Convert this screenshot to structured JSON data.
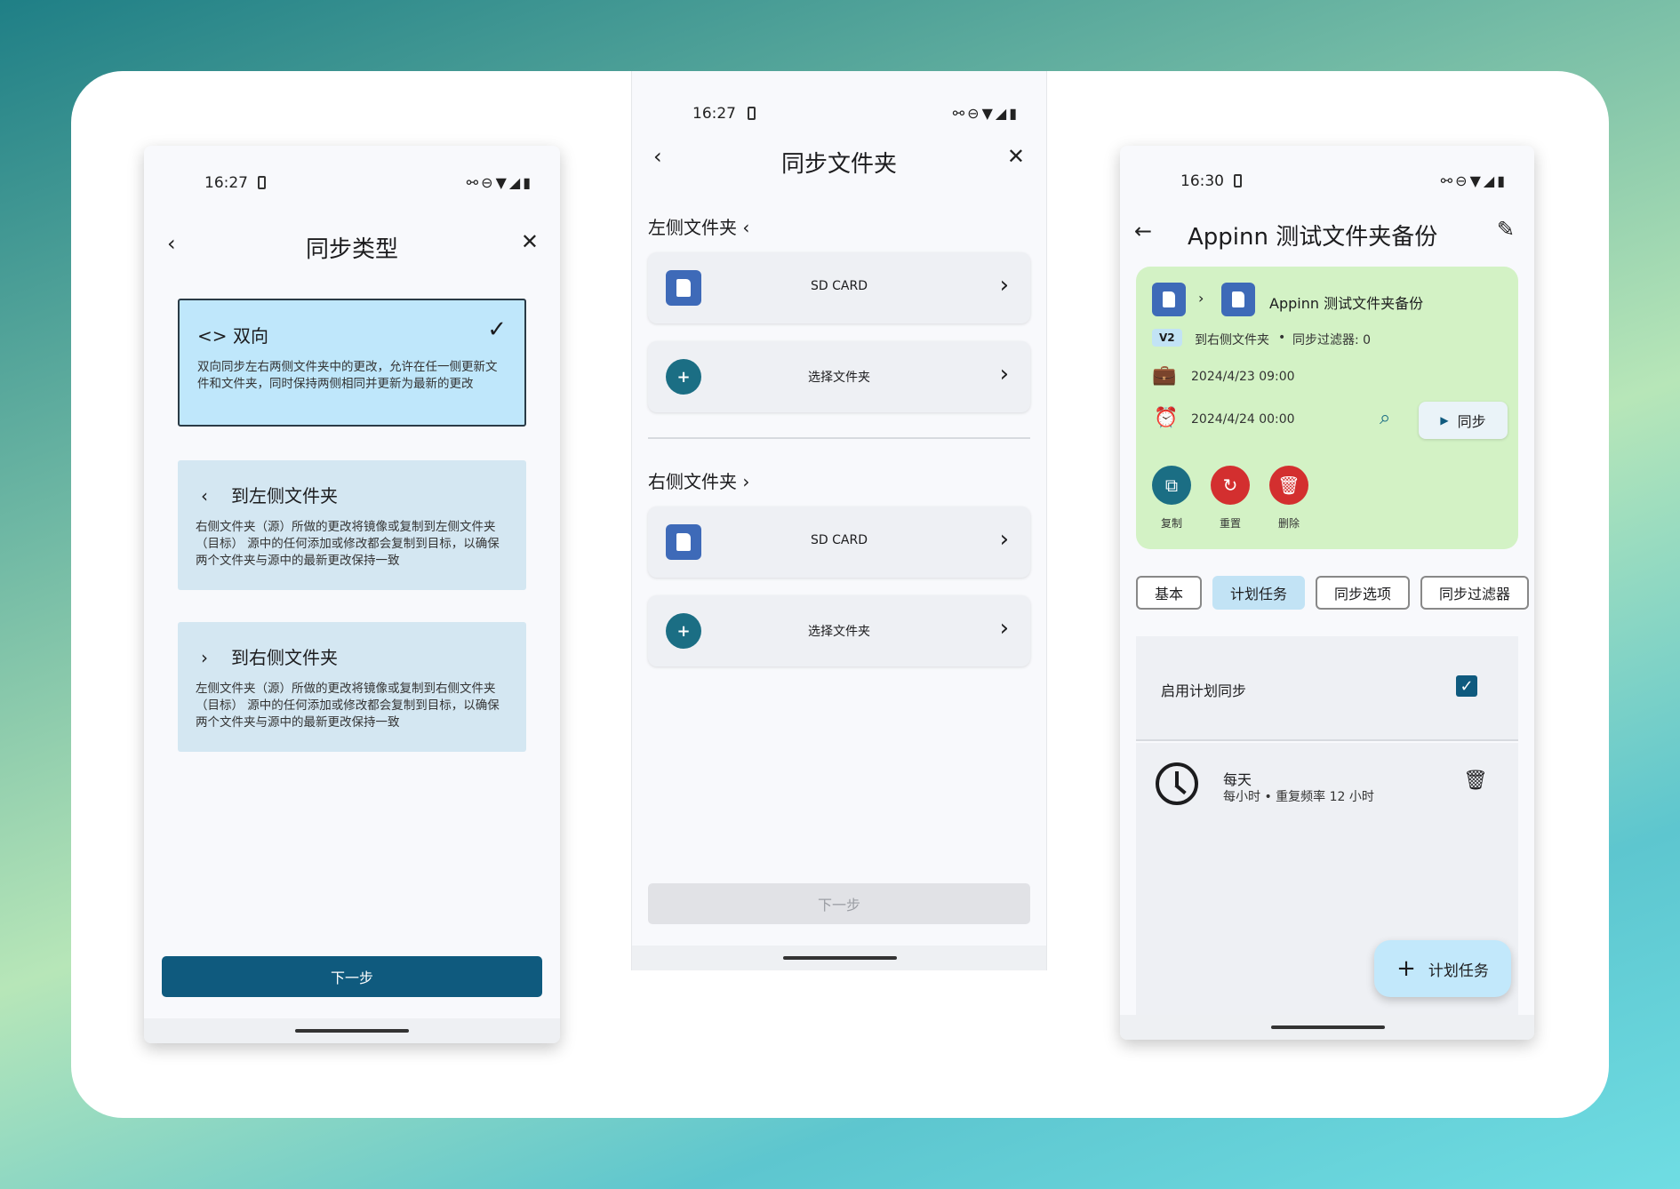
{
  "colors": {
    "primary": "#0f5a7e",
    "selected_option": "#bfe7fb",
    "option": "#d4e7f2",
    "green_card": "#d3f2c5",
    "sd_icon": "#3e6ab8",
    "delete_red": "#d32f2f",
    "copy_teal": "#1b6e84"
  },
  "screen1": {
    "time": "16:27",
    "title": "同步类型",
    "options": [
      {
        "icon": "code-icon",
        "label": "双向",
        "desc": "双向同步左右两侧文件夹中的更改，允许在任一侧更新文件和文件夹，同时保持两侧相同并更新为最新的更改",
        "selected": true
      },
      {
        "icon": "chevron-left-icon",
        "label": "到左侧文件夹",
        "desc": "右侧文件夹（源）所做的更改将镜像或复制到左侧文件夹（目标） 源中的任何添加或修改都会复制到目标，以确保两个文件夹与源中的最新更改保持一致",
        "selected": false
      },
      {
        "icon": "chevron-right-icon",
        "label": "到右侧文件夹",
        "desc": "左侧文件夹（源）所做的更改将镜像或复制到右侧文件夹（目标） 源中的任何添加或修改都会复制到目标，以确保两个文件夹与源中的最新更改保持一致",
        "selected": false
      }
    ],
    "next": "下一步"
  },
  "screen2": {
    "time": "16:27",
    "title": "同步文件夹",
    "left_section": "左侧文件夹",
    "right_section": "右侧文件夹",
    "left_rows": [
      {
        "icon": "sd-card-icon",
        "label": "SD CARD"
      },
      {
        "icon": "add-folder-icon",
        "label": "选择文件夹"
      }
    ],
    "right_rows": [
      {
        "icon": "sd-card-icon",
        "label": "SD CARD"
      },
      {
        "icon": "add-folder-icon",
        "label": "选择文件夹"
      }
    ],
    "next": "下一步"
  },
  "screen3": {
    "time": "16:30",
    "title": "Appinn 测试文件夹备份",
    "card": {
      "name": "Appinn 测试文件夹备份",
      "version": "V2",
      "direction": "到右侧文件夹",
      "filter": "同步过滤器: 0",
      "last_sync": "2024/4/23 09:00",
      "next_sync": "2024/4/24 00:00",
      "sync": "同步",
      "actions": [
        {
          "label": "复制",
          "icon": "copy-icon"
        },
        {
          "label": "重置",
          "icon": "reset-icon"
        },
        {
          "label": "删除",
          "icon": "delete-icon"
        }
      ]
    },
    "tabs": [
      {
        "label": "基本",
        "active": false
      },
      {
        "label": "计划任务",
        "active": true
      },
      {
        "label": "同步选项",
        "active": false
      },
      {
        "label": "同步过滤器",
        "active": false
      }
    ],
    "enable_schedule": "启用计划同步",
    "schedule": {
      "title": "每天",
      "subtitle": "每小时 • 重复频率 12 小时"
    },
    "fab": "计划任务"
  }
}
